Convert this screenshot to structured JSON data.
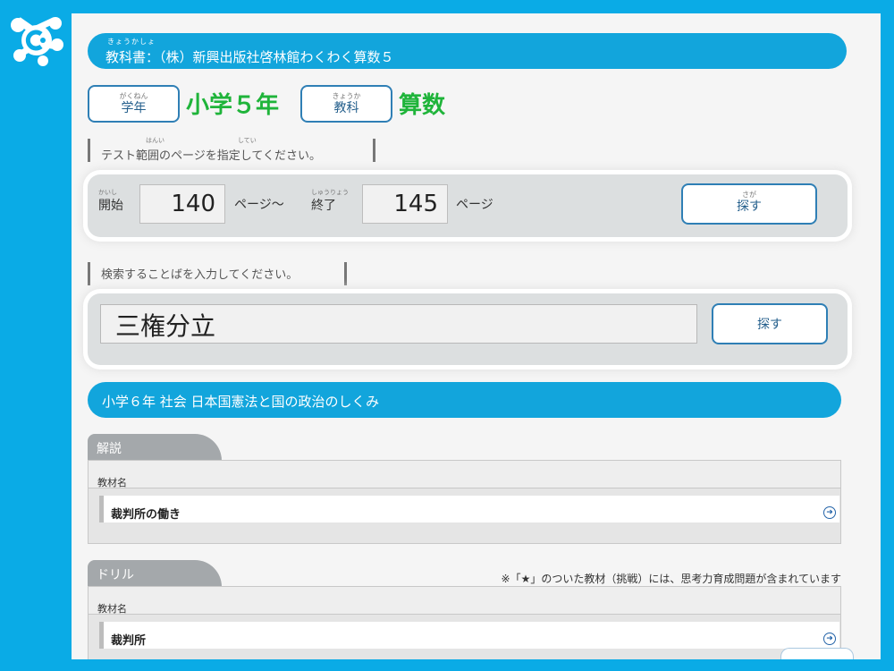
{
  "textbook": {
    "furigana": "きょうかしょ",
    "text": "教科書：（株）新興出版社啓林館わくわく算数５"
  },
  "grade": {
    "button_furigana": "がくねん",
    "button_label": "学年",
    "value": "小学５年"
  },
  "subject": {
    "button_furigana": "きょうか",
    "button_label": "教科",
    "value": "算数"
  },
  "range": {
    "label_furigana_1": "はんい",
    "label_furigana_2": "してい",
    "label": "テスト範囲のページを指定してください。",
    "start_furigana": "かいし",
    "start_label": "開始",
    "start_value": "140",
    "unit_sep": "ページ～",
    "end_furigana": "しゅうりょう",
    "end_label": "終了",
    "end_value": "145",
    "unit": "ページ",
    "search_furigana": "さが",
    "search_label": "探す"
  },
  "keyword": {
    "label": "検索することばを入力してください。",
    "value": "三権分立",
    "search_label": "探す"
  },
  "result": {
    "title": "小学６年 社会 日本国憲法と国の政治のしくみ",
    "explanation": {
      "tab": "解説",
      "header": "教材名",
      "item": "裁判所の働き"
    },
    "drill": {
      "tab": "ドリル",
      "note": "※「★」のついた教材（挑戦）には、思考力育成問題が含まれています",
      "header": "教材名",
      "item": "裁判所"
    }
  },
  "colors": {
    "frame": "#0aabe6",
    "pill": "#12a5dc",
    "green": "#1fb43a",
    "button_border": "#2f7fb5"
  }
}
